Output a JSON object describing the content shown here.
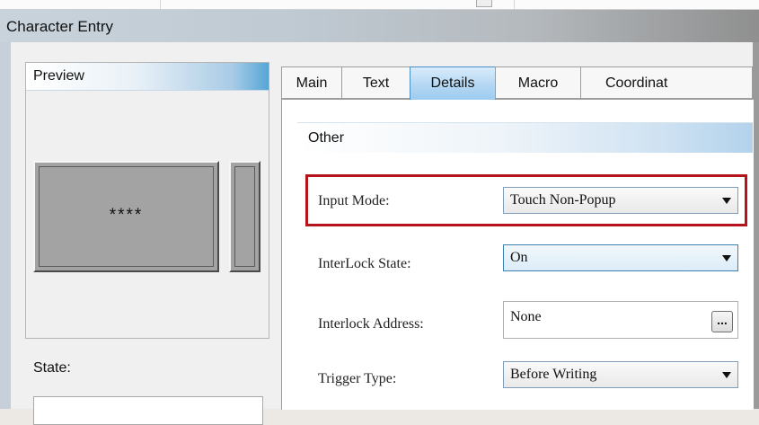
{
  "window": {
    "title": "Character Entry"
  },
  "preview": {
    "header": "Preview",
    "display_text": "****"
  },
  "state": {
    "label": "State:"
  },
  "tabs": [
    {
      "label": "Main",
      "active": false
    },
    {
      "label": "Text",
      "active": false
    },
    {
      "label": "Details",
      "active": true
    },
    {
      "label": "Macro",
      "active": false
    },
    {
      "label": "Coordinat",
      "active": false
    }
  ],
  "group": {
    "title": "Other"
  },
  "fields": {
    "input_mode": {
      "label": "Input Mode:",
      "value": "Touch Non-Popup"
    },
    "interlock_state": {
      "label": "InterLock State:",
      "value": "On"
    },
    "interlock_address": {
      "label": "Interlock Address:",
      "value": "None",
      "browse_label": "..."
    },
    "trigger_type": {
      "label": "Trigger Type:",
      "value": "Before Writing"
    }
  },
  "colors": {
    "highlight": "#b5121b",
    "active_tab": "#9ccbef"
  }
}
